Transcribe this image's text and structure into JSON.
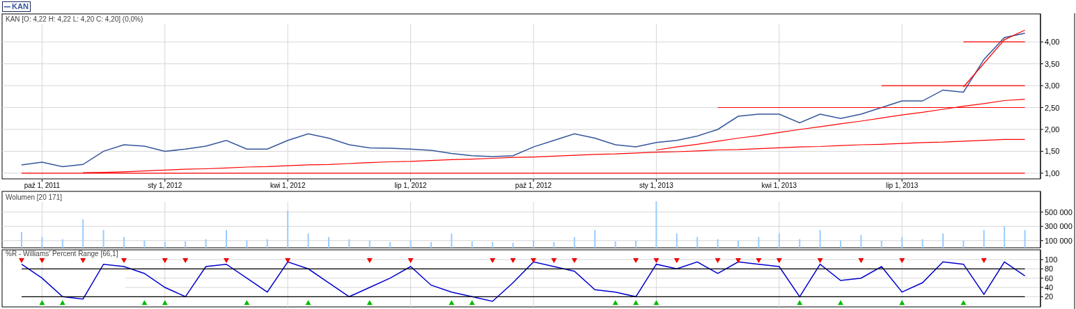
{
  "price_panel": {
    "chart_data": {
      "type": "line",
      "title": "KAN [O: 4,22  H: 4,22  L: 4,20  C: 4,20] (0,0%)",
      "grid": true,
      "categories": [
        null,
        "paź 1, 2011",
        null,
        null,
        null,
        null,
        null,
        "sty 1, 2012",
        null,
        null,
        null,
        null,
        null,
        "kwi 1, 2012",
        null,
        null,
        null,
        null,
        null,
        "lip 1, 2012",
        null,
        null,
        null,
        null,
        null,
        "paź 1, 2012",
        null,
        null,
        null,
        null,
        null,
        "sty 1, 2013",
        null,
        null,
        null,
        null,
        null,
        "kwi 1, 2013",
        null,
        null,
        null,
        null,
        null,
        "lip 1, 2013",
        null,
        null,
        null,
        null,
        null,
        null
      ],
      "series": [
        {
          "name": "KAN",
          "color": "#34559b",
          "values": [
            1.19,
            1.25,
            1.15,
            1.2,
            1.5,
            1.65,
            1.62,
            1.5,
            1.55,
            1.62,
            1.75,
            1.55,
            1.55,
            1.75,
            1.9,
            1.8,
            1.65,
            1.58,
            1.57,
            1.55,
            1.52,
            1.45,
            1.4,
            1.38,
            1.4,
            1.6,
            1.75,
            1.9,
            1.8,
            1.65,
            1.6,
            1.7,
            1.75,
            1.85,
            2,
            2.3,
            2.35,
            2.35,
            2.15,
            2.35,
            2.25,
            2.35,
            2.5,
            2.65,
            2.65,
            2.9,
            2.85,
            3.6,
            4.1,
            4.2
          ]
        },
        {
          "color": "#ff0000",
          "values": [
            1,
            1,
            1,
            1,
            1,
            1,
            1,
            1,
            1,
            1,
            1,
            1,
            1,
            1,
            1,
            1,
            1,
            1,
            1,
            1,
            1,
            1,
            1,
            1,
            1,
            1,
            1,
            1,
            1,
            1,
            1,
            1,
            1,
            1,
            1,
            1,
            1,
            1,
            1,
            1,
            1,
            1,
            1,
            1,
            1,
            1,
            1,
            1,
            1,
            1
          ]
        },
        {
          "color": "#ff0000",
          "values": [
            null,
            null,
            null,
            1.01,
            1.02,
            1.03,
            1.05,
            1.07,
            1.09,
            1.1,
            1.12,
            1.14,
            1.15,
            1.17,
            1.19,
            1.2,
            1.22,
            1.24,
            1.26,
            1.27,
            1.29,
            1.31,
            1.32,
            1.34,
            1.36,
            1.37,
            1.39,
            1.41,
            1.43,
            1.44,
            1.46,
            1.48,
            1.49,
            1.51,
            1.53,
            1.54,
            1.56,
            1.58,
            1.6,
            1.61,
            1.63,
            1.65,
            1.66,
            1.68,
            1.7,
            1.71,
            1.73,
            1.75,
            1.77,
            1.77
          ]
        },
        {
          "color": "#ff0000",
          "values": [
            null,
            null,
            null,
            null,
            null,
            null,
            null,
            null,
            null,
            null,
            null,
            null,
            null,
            null,
            null,
            null,
            null,
            null,
            null,
            null,
            null,
            null,
            null,
            null,
            null,
            null,
            null,
            null,
            null,
            null,
            null,
            1.53,
            1.6,
            1.66,
            1.73,
            1.8,
            1.86,
            1.93,
            2,
            2.06,
            2.13,
            2.19,
            2.26,
            2.33,
            2.39,
            2.46,
            2.53,
            2.59,
            2.66,
            2.69
          ]
        },
        {
          "color": "#ff0000",
          "values": [
            null,
            null,
            null,
            null,
            null,
            null,
            null,
            null,
            null,
            null,
            null,
            null,
            null,
            null,
            null,
            null,
            null,
            null,
            null,
            null,
            null,
            null,
            null,
            null,
            null,
            null,
            null,
            null,
            null,
            null,
            null,
            null,
            null,
            null,
            2.5,
            2.5,
            2.5,
            2.5,
            2.5,
            2.5,
            2.5,
            2.5,
            2.5,
            2.5,
            2.5,
            2.5,
            2.5,
            2.5,
            2.5,
            2.5
          ]
        },
        {
          "color": "#ff0000",
          "values": [
            null,
            null,
            null,
            null,
            null,
            null,
            null,
            null,
            null,
            null,
            null,
            null,
            null,
            null,
            null,
            null,
            null,
            null,
            null,
            null,
            null,
            null,
            null,
            null,
            null,
            null,
            null,
            null,
            null,
            null,
            null,
            null,
            null,
            null,
            null,
            null,
            null,
            null,
            null,
            null,
            null,
            null,
            3,
            3,
            3,
            3,
            3,
            3,
            3,
            3
          ]
        },
        {
          "color": "#ff0000",
          "values": [
            null,
            null,
            null,
            null,
            null,
            null,
            null,
            null,
            null,
            null,
            null,
            null,
            null,
            null,
            null,
            null,
            null,
            null,
            null,
            null,
            null,
            null,
            null,
            null,
            null,
            null,
            null,
            null,
            null,
            null,
            null,
            null,
            null,
            null,
            null,
            null,
            null,
            null,
            null,
            null,
            null,
            null,
            null,
            null,
            null,
            null,
            4,
            4,
            4,
            4
          ]
        },
        {
          "color": "#ff0000",
          "values": [
            null,
            null,
            null,
            null,
            null,
            null,
            null,
            null,
            null,
            null,
            null,
            null,
            null,
            null,
            null,
            null,
            null,
            null,
            null,
            null,
            null,
            null,
            null,
            null,
            null,
            null,
            null,
            null,
            null,
            null,
            null,
            null,
            null,
            null,
            null,
            null,
            null,
            null,
            null,
            null,
            null,
            null,
            null,
            null,
            null,
            null,
            2.97,
            3.51,
            4.05,
            4.27
          ]
        }
      ],
      "ylim": [
        0.87,
        4.64
      ],
      "yticks": [
        {
          "value": 1,
          "label": "1,00"
        },
        {
          "value": 1.5,
          "label": "1,50"
        },
        {
          "value": 2,
          "label": "2,00"
        },
        {
          "value": 2.5,
          "label": "2,50"
        },
        {
          "value": 3,
          "label": "3,00"
        },
        {
          "value": 3.5,
          "label": "3,50"
        },
        {
          "value": 4,
          "label": "4,00"
        }
      ]
    }
  },
  "volume_panel": {
    "chart_data": {
      "type": "bar",
      "title": "Wolumen [20 171]",
      "grid": true,
      "categories": [
        null,
        null,
        null,
        null,
        null,
        null,
        null,
        null,
        null,
        null,
        null,
        null,
        null,
        null,
        null,
        null,
        null,
        null,
        null,
        null,
        null,
        null,
        null,
        null,
        null,
        null,
        null,
        null,
        null,
        null,
        null,
        null,
        null,
        null,
        null,
        null,
        null,
        null,
        null,
        null,
        null,
        null,
        null,
        null,
        null,
        null,
        null,
        null,
        null,
        null
      ],
      "series": [
        {
          "color": "#99ccff",
          "values": [
            220000,
            150000,
            120000,
            400000,
            250000,
            150000,
            100000,
            80000,
            90000,
            120000,
            250000,
            100000,
            120000,
            520000,
            200000,
            150000,
            120000,
            100000,
            80000,
            100000,
            80000,
            200000,
            90000,
            80000,
            70000,
            100000,
            80000,
            150000,
            250000,
            90000,
            100000,
            650000,
            200000,
            150000,
            120000,
            100000,
            150000,
            200000,
            120000,
            250000,
            100000,
            180000,
            100000,
            150000,
            120000,
            200000,
            100000,
            250000,
            300000,
            250000
          ]
        }
      ],
      "ylim": [
        0,
        790000
      ],
      "yticks": [
        {
          "value": 100000,
          "label": "100 000"
        },
        {
          "value": 300000,
          "label": "300 000"
        },
        {
          "value": 500000,
          "label": "500 000"
        }
      ]
    }
  },
  "williams_panel": {
    "chart_data": {
      "type": "line",
      "title": "%R - Williams' Percent Range [66,1]",
      "grid": true,
      "categories": [
        null,
        null,
        null,
        null,
        null,
        null,
        null,
        null,
        null,
        null,
        null,
        null,
        null,
        null,
        null,
        null,
        null,
        null,
        null,
        null,
        null,
        null,
        null,
        null,
        null,
        null,
        null,
        null,
        null,
        null,
        null,
        null,
        null,
        null,
        null,
        null,
        null,
        null,
        null,
        null,
        null,
        null,
        null,
        null,
        null,
        null,
        null,
        null,
        null,
        null
      ],
      "series": [
        {
          "color": "#0000cc",
          "values": [
            90,
            60,
            20,
            15,
            90,
            85,
            70,
            40,
            20,
            85,
            90,
            60,
            30,
            95,
            80,
            50,
            20,
            40,
            60,
            85,
            45,
            30,
            20,
            10,
            50,
            95,
            85,
            75,
            35,
            30,
            20,
            90,
            80,
            95,
            70,
            95,
            90,
            85,
            20,
            90,
            55,
            60,
            85,
            30,
            50,
            95,
            90,
            25,
            95,
            65
          ]
        },
        {
          "color": "#000000",
          "values": [
            80,
            80,
            80,
            80,
            80,
            80,
            80,
            80,
            80,
            80,
            80,
            80,
            80,
            80,
            80,
            80,
            80,
            80,
            80,
            80,
            80,
            80,
            80,
            80,
            80,
            80,
            80,
            80,
            80,
            80,
            80,
            80,
            80,
            80,
            80,
            80,
            80,
            80,
            80,
            80,
            80,
            80,
            80,
            80,
            80,
            80,
            80,
            80,
            80,
            80
          ]
        },
        {
          "color": "#000000",
          "values": [
            20,
            20,
            20,
            20,
            20,
            20,
            20,
            20,
            20,
            20,
            20,
            20,
            20,
            20,
            20,
            20,
            20,
            20,
            20,
            20,
            20,
            20,
            20,
            20,
            20,
            20,
            20,
            20,
            20,
            20,
            20,
            20,
            20,
            20,
            20,
            20,
            20,
            20,
            20,
            20,
            20,
            20,
            20,
            20,
            20,
            20,
            20,
            20,
            20,
            20
          ]
        },
        {
          "type": "scatter",
          "color": "#ee0000",
          "values": [
            100,
            100,
            null,
            100,
            null,
            100,
            null,
            100,
            100,
            null,
            100,
            null,
            null,
            100,
            null,
            null,
            null,
            100,
            null,
            100,
            null,
            null,
            null,
            100,
            100,
            100,
            100,
            100,
            null,
            null,
            100,
            100,
            100,
            null,
            100,
            100,
            100,
            100,
            null,
            100,
            null,
            100,
            null,
            100,
            null,
            null,
            null,
            100,
            null,
            null
          ]
        },
        {
          "type": "scatter",
          "color": "#00bb00",
          "values": [
            null,
            5,
            5,
            null,
            null,
            null,
            5,
            5,
            null,
            null,
            null,
            5,
            null,
            null,
            5,
            null,
            null,
            5,
            null,
            null,
            null,
            5,
            5,
            null,
            null,
            null,
            null,
            null,
            null,
            5,
            5,
            5,
            null,
            null,
            null,
            null,
            null,
            null,
            5,
            null,
            5,
            null,
            null,
            5,
            null,
            null,
            5,
            null,
            null,
            null
          ]
        }
      ],
      "ylim": [
        -2,
        121
      ],
      "yticks": [
        20,
        40,
        60,
        80,
        100
      ]
    }
  }
}
